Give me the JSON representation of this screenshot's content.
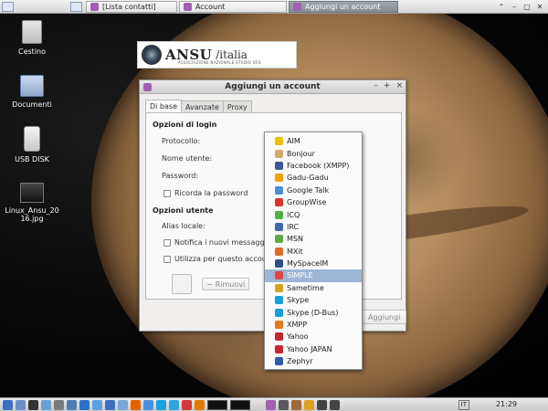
{
  "top_panel": {
    "tasks": [
      {
        "label": "[Lista contatti]",
        "active": false
      },
      {
        "label": "Account",
        "active": false
      },
      {
        "label": "Aggiungi un account",
        "active": true
      }
    ]
  },
  "desktop": {
    "icons": [
      {
        "label": "Cestino",
        "icon": "trash-icon"
      },
      {
        "label": "Documenti",
        "icon": "folder-icon"
      },
      {
        "label": "USB DISK",
        "icon": "usb-drive-icon"
      },
      {
        "label": "Linux_Ansu_2016.jpg",
        "line1": "Linux_Ansu_20",
        "line2": "16.jpg",
        "icon": "image-file-icon"
      }
    ],
    "banner": {
      "brand": "ANSU",
      "suffix": "/italia",
      "tagline": "ASSOCIAZIONE NAZIONALE STUDIO UFO"
    }
  },
  "dialog": {
    "title": "Aggiungi un account",
    "controls": {
      "minimize": "–",
      "maximize": "+",
      "close": "×"
    },
    "tabs": [
      "Di base",
      "Avanzate",
      "Proxy"
    ],
    "login_section": "Opzioni di login",
    "protocol_label": "Protocollo:",
    "username_label": "Nome utente:",
    "password_label": "Password:",
    "remember_password": "Ricorda la password",
    "user_section": "Opzioni utente",
    "local_alias_label": "Alias locale:",
    "notify_new_mail": "Notifica i nuovi messaggi",
    "use_icon": "Utilizza per questo accou",
    "remove_button": "Rimuovi",
    "add_button": "Aggiungi"
  },
  "protocol_menu": {
    "selected": "SIMPLE",
    "items": [
      {
        "label": "AIM",
        "color": "#f0c000"
      },
      {
        "label": "Bonjour",
        "color": "#d8a86a"
      },
      {
        "label": "Facebook (XMPP)",
        "color": "#3b5998"
      },
      {
        "label": "Gadu-Gadu",
        "color": "#f5a000"
      },
      {
        "label": "Google Talk",
        "color": "#4a90d9"
      },
      {
        "label": "GroupWise",
        "color": "#d9342b"
      },
      {
        "label": "ICQ",
        "color": "#52b043"
      },
      {
        "label": "IRC",
        "color": "#3c6bb0"
      },
      {
        "label": "MSN",
        "color": "#5cab45"
      },
      {
        "label": "MXit",
        "color": "#e06a2a"
      },
      {
        "label": "MySpaceIM",
        "color": "#2e4f8a"
      },
      {
        "label": "SIMPLE",
        "color": "#e04545"
      },
      {
        "label": "Sametime",
        "color": "#d9a21a"
      },
      {
        "label": "Skype",
        "color": "#18a0e0"
      },
      {
        "label": "Skype (D-Bus)",
        "color": "#18a0e0"
      },
      {
        "label": "XMPP",
        "color": "#e07c1a"
      },
      {
        "label": "Yahoo",
        "color": "#c5262d"
      },
      {
        "label": "Yahoo JAPAN",
        "color": "#c5262d"
      },
      {
        "label": "Zephyr",
        "color": "#2d5bb0"
      }
    ]
  },
  "bottom_panel": {
    "keyboard_layout": "IT",
    "clock": "21:29",
    "launchers": [
      {
        "icon": "start-menu-icon",
        "color": "#3a6fc4"
      },
      {
        "icon": "folder-icon",
        "color": "#6b8fc9"
      },
      {
        "icon": "terminal-icon",
        "color": "#333333"
      },
      {
        "icon": "text-editor-icon",
        "color": "#6aa0d8"
      },
      {
        "icon": "calculator-icon",
        "color": "#7a7a7a"
      },
      {
        "icon": "settings-icon",
        "color": "#4c7fb8"
      },
      {
        "icon": "help-icon",
        "color": "#2d6ec7"
      },
      {
        "icon": "image-viewer-icon",
        "color": "#5aa0e0"
      },
      {
        "icon": "files-icon",
        "color": "#3a6fc4"
      },
      {
        "icon": "network-icon",
        "color": "#7ba4d9"
      },
      {
        "icon": "firefox-icon",
        "color": "#e66000"
      },
      {
        "icon": "chromium-icon",
        "color": "#4a90e2"
      },
      {
        "icon": "skype-icon",
        "color": "#18a0e0"
      },
      {
        "icon": "telegram-icon",
        "color": "#2ca5e0"
      },
      {
        "icon": "mail-icon",
        "color": "#d33a3a"
      },
      {
        "icon": "vlc-icon",
        "color": "#e07b00"
      }
    ],
    "tray": [
      {
        "icon": "pidgin-icon",
        "color": "#a05fb0"
      },
      {
        "icon": "system-monitor-icon",
        "color": "#5a5a5a"
      },
      {
        "icon": "user-icon",
        "color": "#a06a3a"
      },
      {
        "icon": "update-icon",
        "color": "#e0a020"
      },
      {
        "icon": "volume-icon",
        "color": "#444444"
      },
      {
        "icon": "network-tray-icon",
        "color": "#444444"
      }
    ]
  }
}
